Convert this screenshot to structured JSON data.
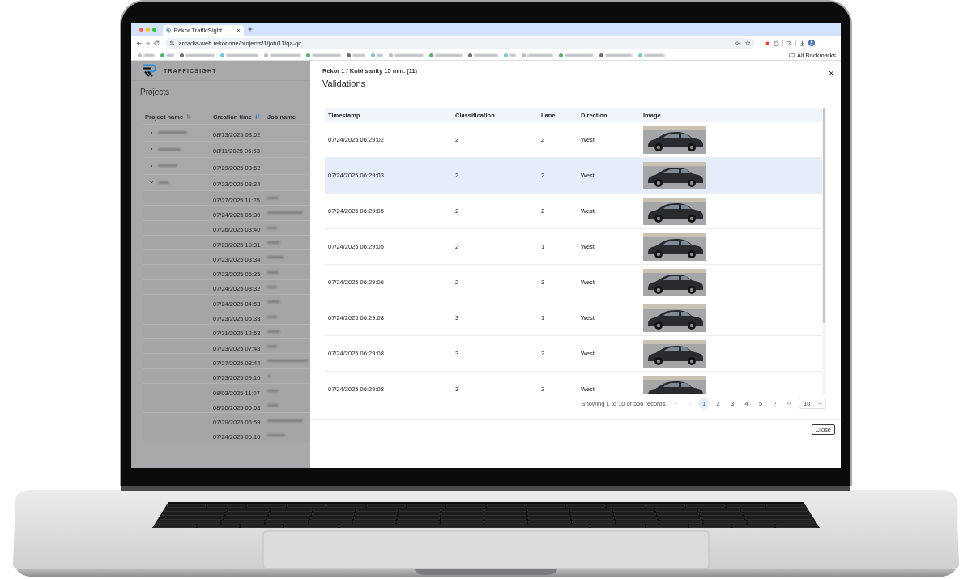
{
  "browser": {
    "tab": {
      "title": "Rekor TrafficSight"
    },
    "address_bar": {
      "url": "arcadia-web.rekor.one/projects/1/job/11/qa-qc"
    },
    "bookmarks_bar": {
      "all_bookmarks": "All Bookmarks"
    }
  },
  "app": {
    "logo_text": "TRAFFICSIGHT",
    "title": "Projects",
    "table": {
      "columns": [
        {
          "label": "Project name",
          "kind": "sortable"
        },
        {
          "label": "Creation time",
          "kind": "sorted"
        },
        {
          "label": "Job name",
          "kind": "plain"
        }
      ],
      "projects": [
        {
          "creation_time": "08/13/2025 08:52",
          "expanded": false
        },
        {
          "creation_time": "08/11/2025 05:53",
          "expanded": false
        },
        {
          "creation_time": "07/29/2025 03:52",
          "expanded": false
        },
        {
          "creation_time": "07/23/2025 03:34",
          "expanded": true,
          "children": [
            {
              "creation_time": "07/27/2025 11:25"
            },
            {
              "creation_time": "07/24/2025 06:30"
            },
            {
              "creation_time": "07/26/2025 03:40"
            },
            {
              "creation_time": "07/23/2025 10:31"
            },
            {
              "creation_time": "07/23/2025 03:34"
            },
            {
              "creation_time": "07/23/2025 06:35"
            },
            {
              "creation_time": "07/24/2025 03:32"
            },
            {
              "creation_time": "07/24/2025 04:53"
            },
            {
              "creation_time": "07/23/2025 06:33"
            },
            {
              "creation_time": "07/31/2025 12:53"
            },
            {
              "creation_time": "07/23/2025 07:48"
            },
            {
              "creation_time": "07/27/2025 08:44"
            },
            {
              "creation_time": "07/23/2025 09:10"
            },
            {
              "creation_time": "08/03/2025 11:07"
            },
            {
              "creation_time": "08/20/2025 06:58"
            },
            {
              "creation_time": "07/29/2025 06:59"
            },
            {
              "creation_time": "07/24/2025 06:10"
            }
          ]
        }
      ]
    }
  },
  "drawer": {
    "breadcrumb": "Rekor 1 / Kobi sanity 15 min. (11)",
    "title": "Validations",
    "table": {
      "columns": [
        "Timestamp",
        "Classification",
        "Lane",
        "Direction",
        "Image"
      ],
      "rows": [
        {
          "timestamp": "07/24/2025 06:29:02",
          "classification": "2",
          "lane": "2",
          "direction": "West",
          "highlighted": false
        },
        {
          "timestamp": "07/24/2025 06:29:03",
          "classification": "2",
          "lane": "2",
          "direction": "West",
          "highlighted": true
        },
        {
          "timestamp": "07/24/2025 06:29:05",
          "classification": "2",
          "lane": "2",
          "direction": "West",
          "highlighted": false
        },
        {
          "timestamp": "07/24/2025 06:29:05",
          "classification": "2",
          "lane": "1",
          "direction": "West",
          "highlighted": false
        },
        {
          "timestamp": "07/24/2025 06:29:06",
          "classification": "2",
          "lane": "3",
          "direction": "West",
          "highlighted": false
        },
        {
          "timestamp": "07/24/2025 06:29:08",
          "classification": "3",
          "lane": "1",
          "direction": "West",
          "highlighted": false
        },
        {
          "timestamp": "07/24/2025 06:29:08",
          "classification": "3",
          "lane": "2",
          "direction": "West",
          "highlighted": false
        },
        {
          "timestamp": "07/24/2025 06:29:08",
          "classification": "3",
          "lane": "3",
          "direction": "West",
          "highlighted": false
        }
      ]
    },
    "pagination": {
      "summary": "Showing 1 to 10 of 556 records",
      "nav_start": [
        {
          "kind": "first",
          "disabled": true
        },
        {
          "kind": "prev",
          "disabled": true
        }
      ],
      "pages": [
        {
          "label": "1",
          "selected": true
        },
        {
          "label": "2",
          "selected": false
        },
        {
          "label": "3",
          "selected": false
        },
        {
          "label": "4",
          "selected": false
        },
        {
          "label": "5",
          "selected": false
        }
      ],
      "nav_end": [
        {
          "kind": "next",
          "disabled": false
        },
        {
          "kind": "last",
          "disabled": false
        }
      ],
      "page_size": "10"
    },
    "close_button": "Close"
  }
}
